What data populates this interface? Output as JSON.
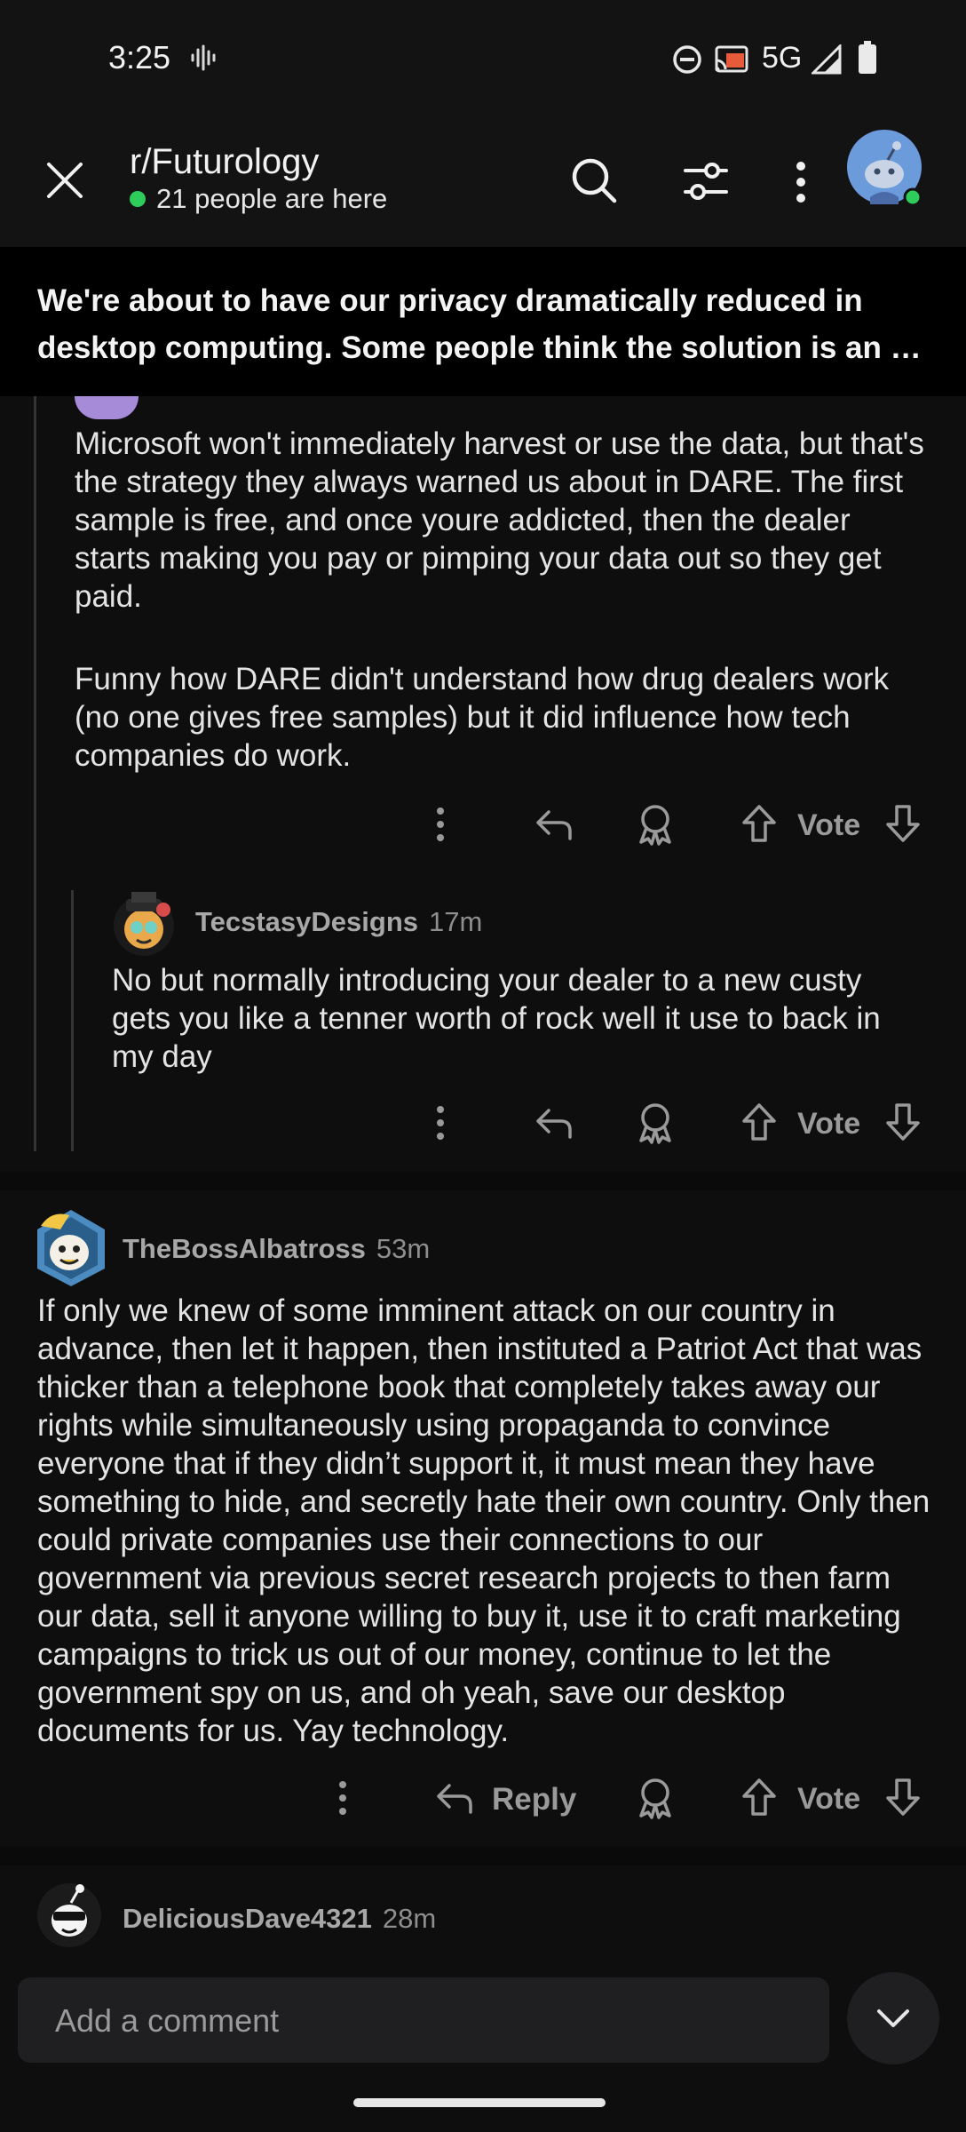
{
  "status_bar": {
    "time": "3:25",
    "network": "5G"
  },
  "header": {
    "subreddit": "r/Futurology",
    "presence": "21 people are here"
  },
  "post": {
    "title_line1": "We're about to have our privacy dramatically reduced in",
    "title_line2": "desktop computing. Some people think the solution is an op…"
  },
  "comments": [
    {
      "paragraph1": "Microsoft won't immediately harvest or use the data, but that's the strategy they always warned us about in DARE. The first sample is free, and once youre addicted, then the dealer starts making you pay or pimping your data out so they get paid.",
      "paragraph2": "Funny how DARE didn't understand how drug dealers work (no one gives free samples) but it did influence how tech companies do work.",
      "vote_label": "Vote"
    },
    {
      "author": "TecstasyDesigns",
      "age": "17m",
      "body": "No but normally introducing your dealer to a new custy gets you like a tenner worth of rock well it use to back in my day",
      "vote_label": "Vote"
    },
    {
      "author": "TheBossAlbatross",
      "age": "53m",
      "body": "If only we knew of some imminent attack on our country in advance, then let it happen, then instituted a Patriot Act that was thicker than a telephone book that completely takes away our rights while simultaneously using propaganda to convince everyone that if they didn’t support it, it must mean they have something to hide, and secretly hate their own country. Only then could private companies use their connections to our government via previous secret research projects to then farm our data, sell it anyone willing to buy it, use it to craft marketing campaigns to trick us out of our money, continue to let the government spy on us, and oh yeah, save our desktop documents for us. Yay technology.",
      "reply_label": "Reply",
      "vote_label": "Vote"
    },
    {
      "author": "DeliciousDave4321",
      "age": "28m"
    }
  ],
  "composer": {
    "placeholder": "Add a comment"
  },
  "colors": {
    "presence_dot": "#2ecc5b",
    "avatar_blue": "#6c9bdc",
    "background": "#0e0e0f"
  }
}
